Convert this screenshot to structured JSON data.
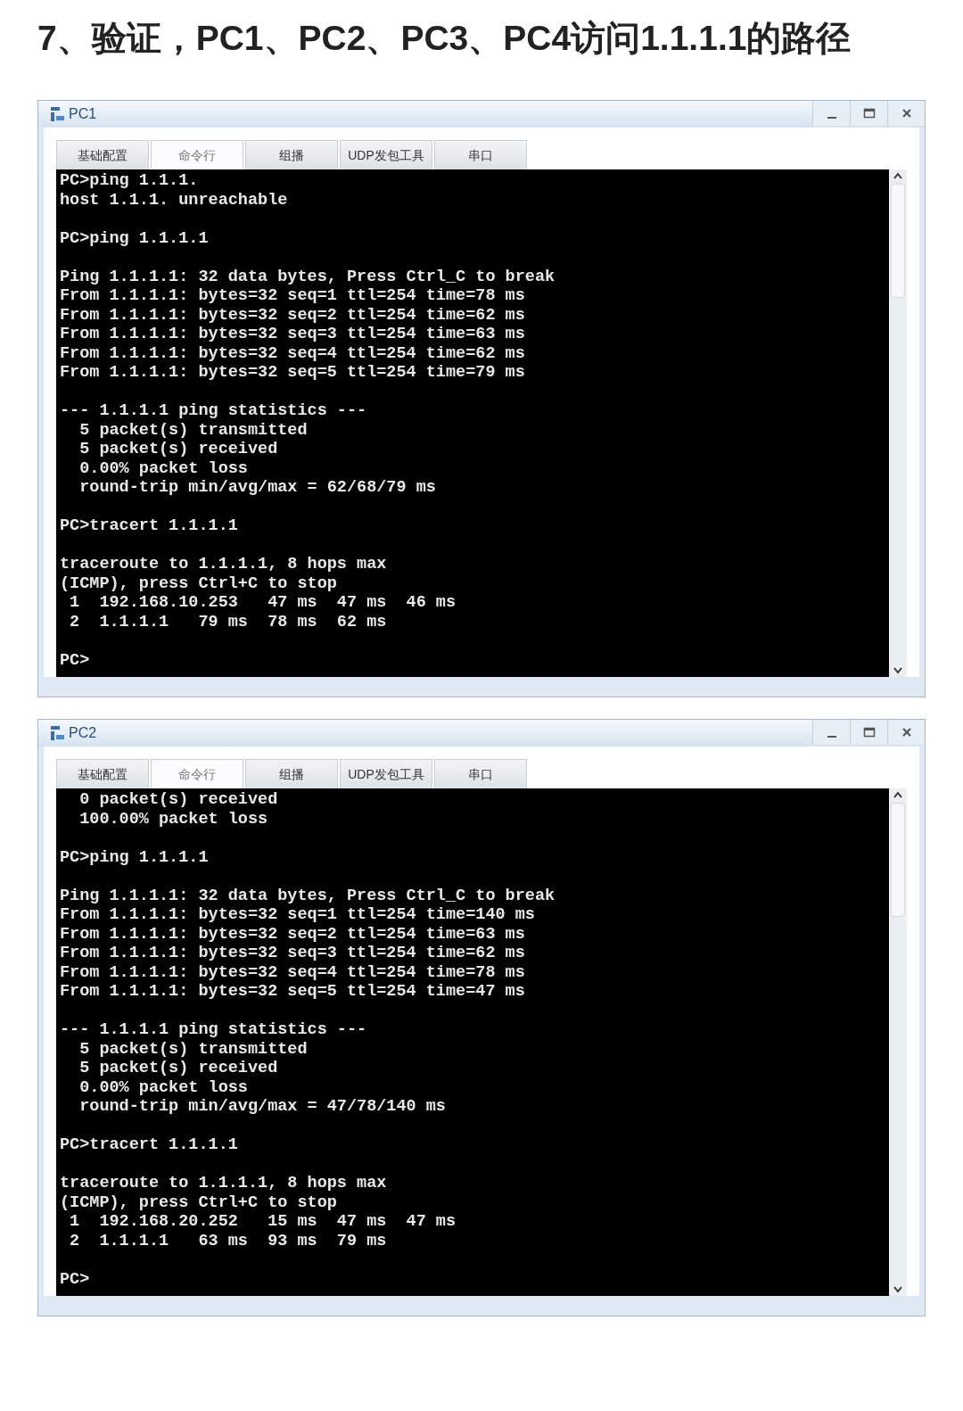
{
  "heading": "7、验证，PC1、PC2、PC3、PC4访问1.1.1.1的路径",
  "windows": [
    {
      "title": "PC1",
      "tabs": [
        {
          "label": "基础配置",
          "selected": false
        },
        {
          "label": "命令行",
          "selected": true
        },
        {
          "label": "组播",
          "selected": false
        },
        {
          "label": "UDP发包工具",
          "selected": false
        },
        {
          "label": "串口",
          "selected": false
        }
      ],
      "blocks": [
        [
          "PC>ping 1.1.1.",
          "host 1.1.1. unreachable"
        ],
        [
          "PC>ping 1.1.1.1"
        ],
        [
          "Ping 1.1.1.1: 32 data bytes, Press Ctrl_C to break",
          "From 1.1.1.1: bytes=32 seq=1 ttl=254 time=78 ms",
          "From 1.1.1.1: bytes=32 seq=2 ttl=254 time=62 ms",
          "From 1.1.1.1: bytes=32 seq=3 ttl=254 time=63 ms",
          "From 1.1.1.1: bytes=32 seq=4 ttl=254 time=62 ms",
          "From 1.1.1.1: bytes=32 seq=5 ttl=254 time=79 ms"
        ],
        [
          "--- 1.1.1.1 ping statistics ---",
          "  5 packet(s) transmitted",
          "  5 packet(s) received",
          "  0.00% packet loss",
          "  round-trip min/avg/max = 62/68/79 ms"
        ],
        [
          "PC>tracert 1.1.1.1"
        ],
        [
          "traceroute to 1.1.1.1, 8 hops max",
          "(ICMP), press Ctrl+C to stop",
          " 1  192.168.10.253   47 ms  47 ms  46 ms",
          " 2  1.1.1.1   79 ms  78 ms  62 ms"
        ],
        [
          "PC>"
        ]
      ]
    },
    {
      "title": "PC2",
      "tabs": [
        {
          "label": "基础配置",
          "selected": false
        },
        {
          "label": "命令行",
          "selected": true
        },
        {
          "label": "组播",
          "selected": false
        },
        {
          "label": "UDP发包工具",
          "selected": false
        },
        {
          "label": "串口",
          "selected": false
        }
      ],
      "blocks": [
        [
          "  0 packet(s) received",
          "  100.00% packet loss"
        ],
        [
          "PC>ping 1.1.1.1"
        ],
        [
          "Ping 1.1.1.1: 32 data bytes, Press Ctrl_C to break",
          "From 1.1.1.1: bytes=32 seq=1 ttl=254 time=140 ms",
          "From 1.1.1.1: bytes=32 seq=2 ttl=254 time=63 ms",
          "From 1.1.1.1: bytes=32 seq=3 ttl=254 time=62 ms",
          "From 1.1.1.1: bytes=32 seq=4 ttl=254 time=78 ms",
          "From 1.1.1.1: bytes=32 seq=5 ttl=254 time=47 ms"
        ],
        [
          "--- 1.1.1.1 ping statistics ---",
          "  5 packet(s) transmitted",
          "  5 packet(s) received",
          "  0.00% packet loss",
          "  round-trip min/avg/max = 47/78/140 ms"
        ],
        [
          "PC>tracert 1.1.1.1"
        ],
        [
          "traceroute to 1.1.1.1, 8 hops max",
          "(ICMP), press Ctrl+C to stop",
          " 1  192.168.20.252   15 ms  47 ms  47 ms",
          " 2  1.1.1.1   63 ms  93 ms  79 ms"
        ],
        [
          "PC>"
        ]
      ]
    }
  ]
}
